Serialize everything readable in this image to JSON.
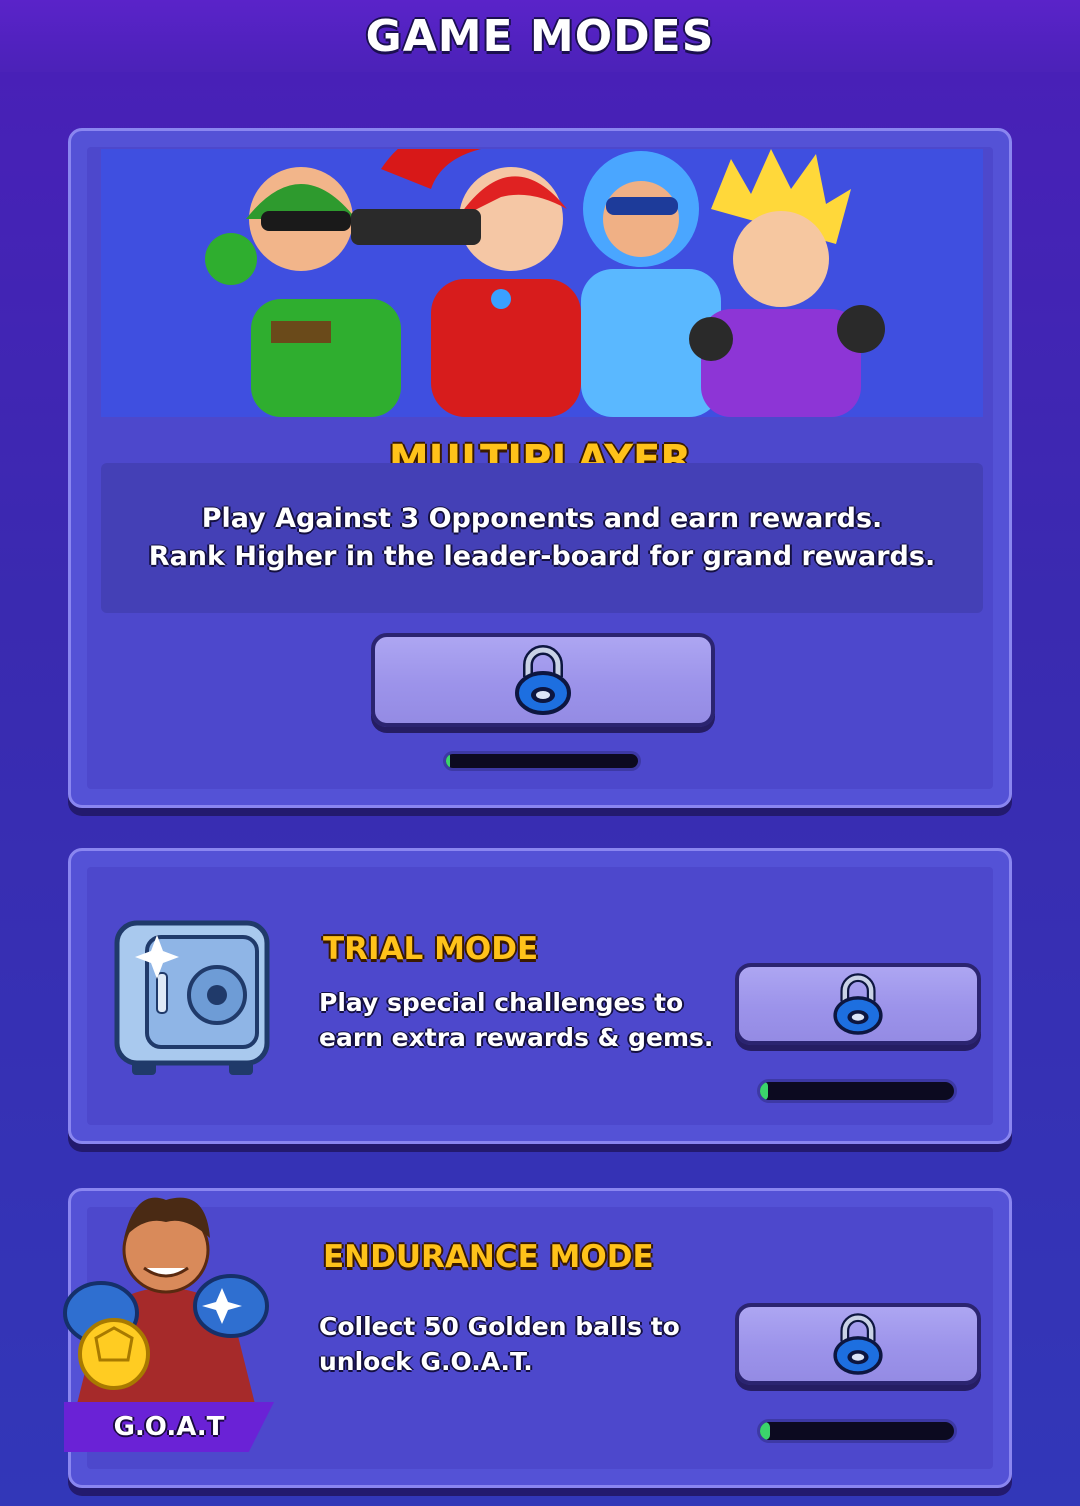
{
  "header": {
    "title": "GAME MODES"
  },
  "multiplayer": {
    "title": "MULTIPLAYER",
    "description_lines": [
      "Play Against 3 Opponents and earn rewards.",
      "Rank Higher in the leader-board for grand rewards."
    ],
    "button_icon": "lock-icon",
    "progress": 0.02
  },
  "trial": {
    "title": "TRIAL MODE",
    "description_lines": [
      "Play special challenges to",
      "earn extra rewards & gems."
    ],
    "image_icon": "safe-icon",
    "button_icon": "lock-icon",
    "progress": 0.04
  },
  "endurance": {
    "title": "ENDURANCE MODE",
    "description_lines": [
      "Collect 50 Golden balls to",
      "unlock G.O.A.T."
    ],
    "image_icon": "goat-character-icon",
    "tag": "G.O.A.T",
    "button_icon": "lock-icon",
    "progress": 0.05
  },
  "colors": {
    "heading": "#ffc21a",
    "panel": "#5452d6",
    "progress_fill": "#3bd36b"
  }
}
